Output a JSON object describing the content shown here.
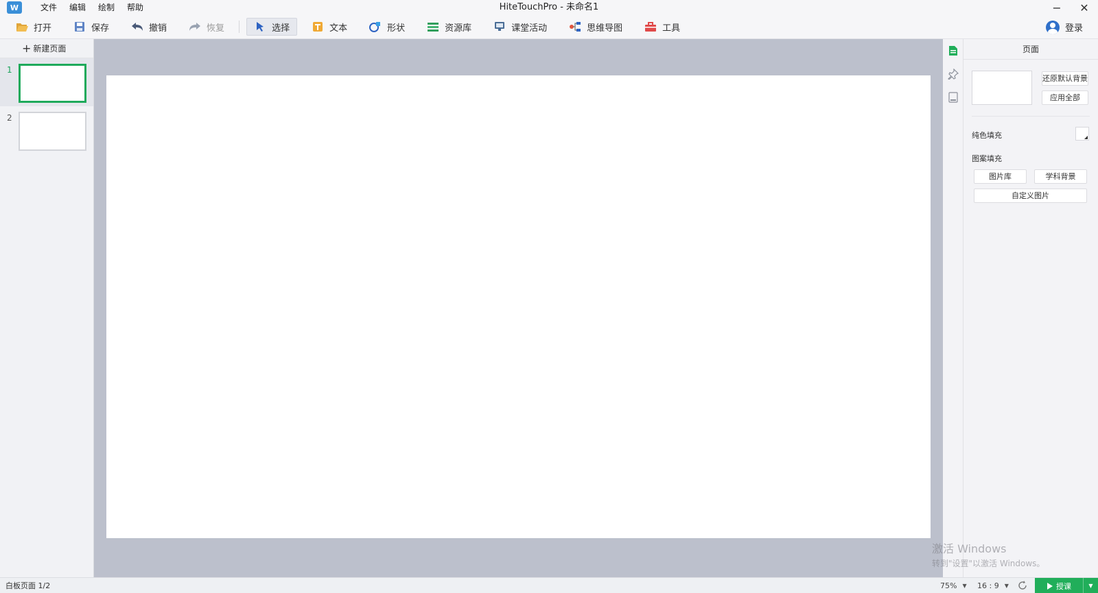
{
  "window": {
    "title": "HiteTouchPro - 未命名1",
    "minimize_label": "−",
    "close_label": "✕"
  },
  "menu": [
    {
      "label": "文件"
    },
    {
      "label": "编辑"
    },
    {
      "label": "绘制"
    },
    {
      "label": "帮助"
    }
  ],
  "toolbar": {
    "open": {
      "label": "打开",
      "icon": "folder-open-icon"
    },
    "save": {
      "label": "保存",
      "icon": "save-icon"
    },
    "undo": {
      "label": "撤销",
      "icon": "undo-icon"
    },
    "redo": {
      "label": "恢复",
      "icon": "redo-icon"
    },
    "select": {
      "label": "选择",
      "icon": "cursor-icon"
    },
    "text": {
      "label": "文本",
      "icon": "text-icon"
    },
    "shape": {
      "label": "形状",
      "icon": "shape-icon"
    },
    "library": {
      "label": "资源库",
      "icon": "library-icon"
    },
    "activity": {
      "label": "课堂活动",
      "icon": "classroom-activity-icon"
    },
    "mindmap": {
      "label": "思维导图",
      "icon": "mindmap-icon"
    },
    "tools": {
      "label": "工具",
      "icon": "toolbox-icon"
    },
    "login": {
      "label": "登录"
    }
  },
  "sidebar": {
    "new_page_label": "新建页面",
    "pages": [
      {
        "num": "1",
        "selected": true
      },
      {
        "num": "2",
        "selected": false
      }
    ]
  },
  "props": {
    "header": "页面",
    "restore_default_bg": "还原默认背景",
    "apply_all": "应用全部",
    "solid_fill_label": "纯色填充",
    "pattern_fill_label": "图案填充",
    "image_library": "图片库",
    "subject_background": "学科背景",
    "custom_image": "自定义图片"
  },
  "watermark": {
    "line1": "激活 Windows",
    "line2": "转到\"设置\"以激活 Windows。"
  },
  "status": {
    "page_info": "白板页面 1/2",
    "zoom": "75%",
    "ratio": "16 : 9",
    "present_label": "授课"
  },
  "colors": {
    "accent_green": "#21ae5a",
    "canvas_bg": "#bcc0cc",
    "slide_bg": "#ffffff"
  }
}
